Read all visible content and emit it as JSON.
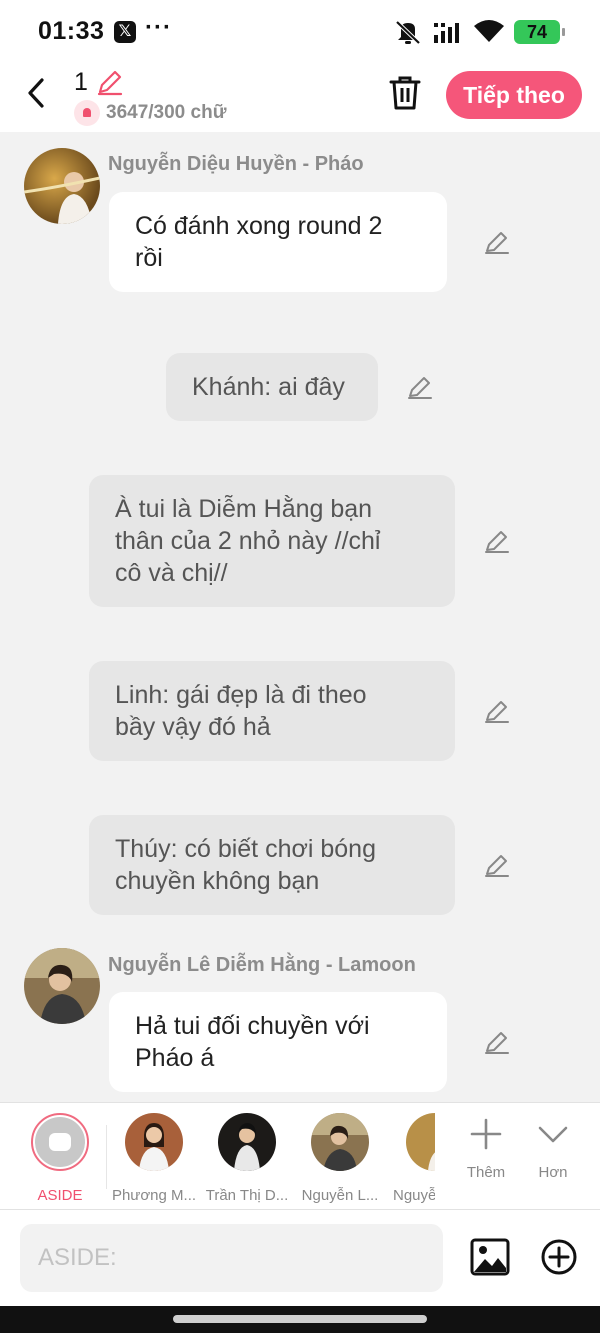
{
  "status_bar": {
    "time": "01:33",
    "x_badge": "𝕏",
    "dots": "···",
    "battery": "74",
    "icons": [
      "mute-icon",
      "signal-icon",
      "wifi-icon",
      "battery-icon"
    ]
  },
  "header": {
    "title": "1",
    "word_count": "3647/300 chữ",
    "next_label": "Tiếp theo",
    "accent_color": "#f5567a"
  },
  "messages": [
    {
      "type": "character",
      "sender": "Nguyễn Diệu Huyền - Pháo",
      "lines": [
        "Có đánh xong round 2",
        "rồi"
      ]
    },
    {
      "type": "narration",
      "lines": [
        "Khánh: ai đây"
      ]
    },
    {
      "type": "narration",
      "lines": [
        "À tui là Diễm Hằng bạn",
        "thân của 2 nhỏ này //chỉ",
        "cô và chị//"
      ]
    },
    {
      "type": "narration",
      "lines": [
        "Linh: gái đẹp là đi theo",
        "bầy vậy đó hả"
      ]
    },
    {
      "type": "narration",
      "lines": [
        "Thúy: có biết chơi bóng",
        "chuyền không bạn"
      ]
    },
    {
      "type": "character",
      "sender": "Nguyễn Lê Diễm Hằng - Lamoon",
      "lines": [
        "Hả tui đối chuyền với",
        "Pháo á"
      ]
    }
  ],
  "character_bar": {
    "items": [
      {
        "label": "ASIDE",
        "selected": true
      },
      {
        "label": "Phương M..."
      },
      {
        "label": "Trần Thị D..."
      },
      {
        "label": "Nguyễn L..."
      },
      {
        "label": "Nguyễ"
      }
    ],
    "add_label": "Thêm",
    "more_label": "Hơn"
  },
  "input": {
    "placeholder": "ASIDE:"
  }
}
